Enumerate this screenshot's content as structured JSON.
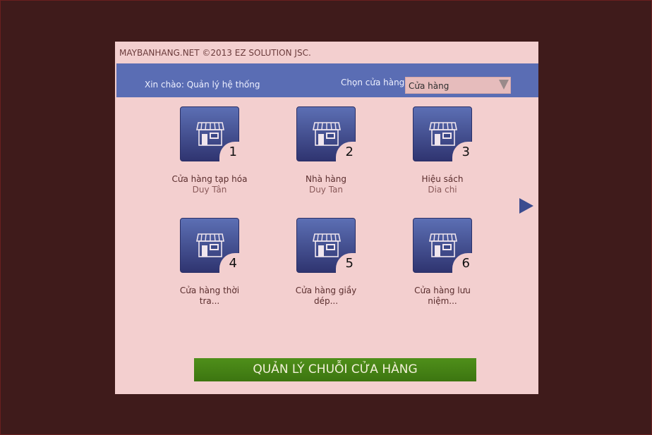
{
  "copyright": "MAYBANHANG.NET ©2013 EZ SOLUTION JSC.",
  "header": {
    "greeting": "Xin chào: Quản lý hệ thống",
    "store_label": "Chọn cửa hàng",
    "store_select_value": "Cửa hàng"
  },
  "stores": [
    {
      "number": "1",
      "name": "Cửa hàng tạp hóa",
      "address": "Duy Tân",
      "icon": "storefront-icon"
    },
    {
      "number": "2",
      "name": "Nhà hàng",
      "address": "Duy Tan",
      "icon": "storefront-icon"
    },
    {
      "number": "3",
      "name": "Hiệu sách",
      "address": "Dia chi",
      "icon": "storefront-icon"
    },
    {
      "number": "4",
      "name": "Cửa hàng thời tra...",
      "address": "",
      "icon": "storefront-icon"
    },
    {
      "number": "5",
      "name": "Cửa hàng giầy dép...",
      "address": "",
      "icon": "storefront-icon"
    },
    {
      "number": "6",
      "name": "Cửa hàng lưu niệm...",
      "address": "",
      "icon": "storefront-icon"
    }
  ],
  "next_icon": "next-arrow-icon",
  "chain_button_label": "QUẢN LÝ CHUỖI CỬA HÀNG",
  "colors": {
    "background": "#3f1b1b",
    "panel": "#f3cfcf",
    "header": "#5a6db4",
    "tile": "#46549a",
    "chain_button": "#4a8a18"
  }
}
